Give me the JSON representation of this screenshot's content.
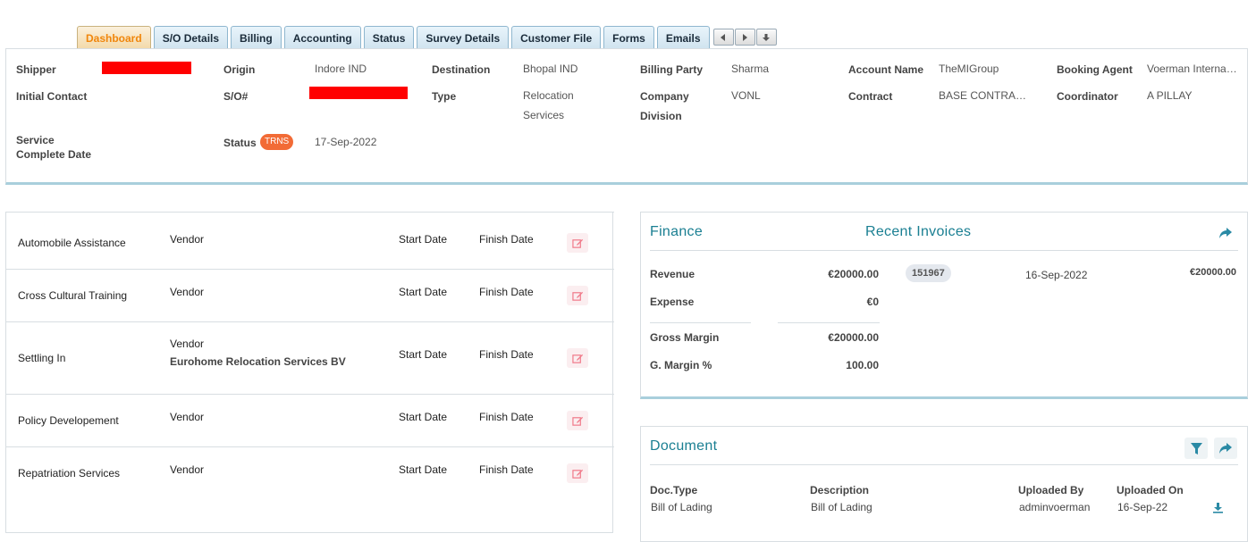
{
  "tabs": [
    {
      "label": "Dashboard",
      "active": true
    },
    {
      "label": "S/O Details"
    },
    {
      "label": "Billing"
    },
    {
      "label": "Accounting"
    },
    {
      "label": "Status"
    },
    {
      "label": "Survey Details"
    },
    {
      "label": "Customer File"
    },
    {
      "label": "Forms"
    },
    {
      "label": "Emails"
    }
  ],
  "tab_arrows": [
    "arrow-left-icon",
    "arrow-right-icon",
    "arrow-down-icon"
  ],
  "header": {
    "shipper_label": "Shipper",
    "initial_contact_label": "Initial Contact",
    "service_complete_label": "Service Complete Date",
    "origin_label": "Origin",
    "origin_value": "Indore IND",
    "so_label": "S/O#",
    "status_label": "Status",
    "status_badge": "TRNS",
    "status_date": "17-Sep-2022",
    "destination_label": "Destination",
    "destination_value": "Bhopal IND",
    "type_label": "Type",
    "type_value": "Relocation Services",
    "billing_party_label": "Billing Party",
    "billing_party_value": "Sharma",
    "company_division_label": "Company Division",
    "company_division_value": "VONL",
    "account_name_label": "Account Name",
    "account_name_value": "TheMIGroup",
    "contract_label": "Contract",
    "contract_value": "BASE CONTRA…",
    "booking_agent_label": "Booking Agent",
    "booking_agent_value": "Voerman Interna…",
    "coordinator_label": "Coordinator",
    "coordinator_value": "A PILLAY"
  },
  "services": [
    {
      "name": "Automobile Assistance",
      "vendor": "Vendor",
      "vendor_name": "",
      "start": "Start Date",
      "finish": "Finish Date"
    },
    {
      "name": "Cross Cultural Training",
      "vendor": "Vendor",
      "vendor_name": "",
      "start": "Start Date",
      "finish": "Finish Date"
    },
    {
      "name": "Settling In",
      "vendor": "Vendor",
      "vendor_name": "Eurohome Relocation Services BV",
      "start": "Start Date",
      "finish": "Finish Date"
    },
    {
      "name": "Policy Developement",
      "vendor": "Vendor",
      "vendor_name": "",
      "start": "Start Date",
      "finish": "Finish Date"
    },
    {
      "name": "Repatriation Services",
      "vendor": "Vendor",
      "vendor_name": "",
      "start": "Start Date",
      "finish": "Finish Date"
    }
  ],
  "finance": {
    "title": "Finance",
    "recent_invoices_title": "Recent Invoices",
    "revenue_label": "Revenue",
    "revenue_value": "€20000.00",
    "expense_label": "Expense",
    "expense_value": "€0",
    "gross_margin_label": "Gross Margin",
    "gross_margin_value": "€20000.00",
    "margin_pct_label": "G. Margin %",
    "margin_pct_value": "100.00",
    "invoice_number": "151967",
    "invoice_date": "16-Sep-2022",
    "invoice_amount": "€20000.00"
  },
  "document": {
    "title": "Document",
    "headers": {
      "doc_type": "Doc.Type",
      "description": "Description",
      "uploaded_by": "Uploaded By",
      "uploaded_on": "Uploaded On"
    },
    "rows": [
      {
        "doc_type": "Bill of Lading",
        "description": "Bill of Lading",
        "uploaded_by": "adminvoerman",
        "uploaded_on": "16-Sep-22"
      }
    ]
  },
  "colors": {
    "accent": "#1a7f92",
    "tab_active": "#f0860c",
    "status_badge": "#f26b36",
    "edit_icon": "#f07a8a"
  }
}
